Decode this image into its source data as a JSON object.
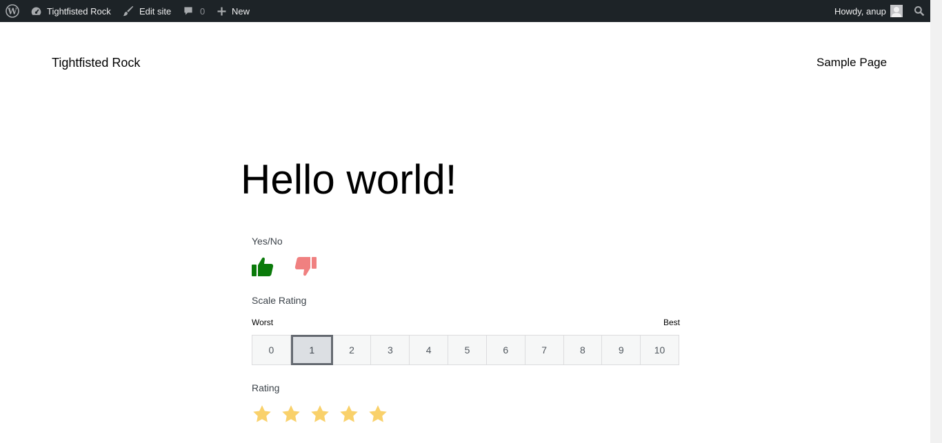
{
  "admin_bar": {
    "site_name": "Tightfisted Rock",
    "edit_site": "Edit site",
    "comments_count": "0",
    "new_label": "New",
    "howdy": "Howdy, anup"
  },
  "header": {
    "site_title": "Tightfisted Rock",
    "nav": [
      "Sample Page"
    ]
  },
  "post": {
    "title": "Hello world!"
  },
  "rating_block": {
    "yes_no": {
      "label": "Yes/No"
    },
    "scale": {
      "label": "Scale Rating",
      "worst_label": "Worst",
      "best_label": "Best",
      "options": [
        "0",
        "1",
        "2",
        "3",
        "4",
        "5",
        "6",
        "7",
        "8",
        "9",
        "10"
      ],
      "selected_index": 1
    },
    "stars": {
      "label": "Rating",
      "count": 5,
      "color": "#f9d16b"
    }
  },
  "colors": {
    "admin_bar_bg": "#1d2327",
    "thumbs_up": "#0a7a0a",
    "thumbs_down": "#f08080"
  }
}
